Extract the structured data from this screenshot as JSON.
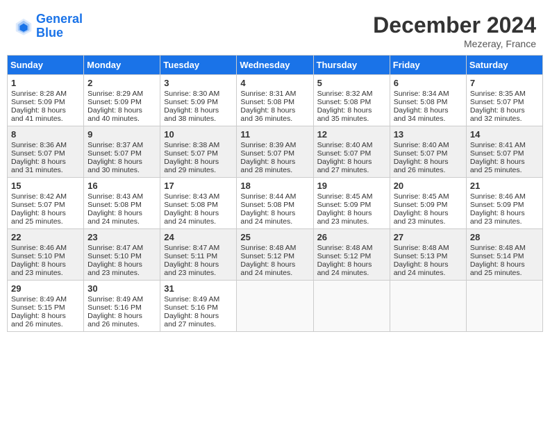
{
  "header": {
    "logo_line1": "General",
    "logo_line2": "Blue",
    "month_title": "December 2024",
    "location": "Mezeray, France"
  },
  "weekdays": [
    "Sunday",
    "Monday",
    "Tuesday",
    "Wednesday",
    "Thursday",
    "Friday",
    "Saturday"
  ],
  "weeks": [
    [
      {
        "day": "1",
        "sunrise": "Sunrise: 8:28 AM",
        "sunset": "Sunset: 5:09 PM",
        "daylight": "Daylight: 8 hours and 41 minutes."
      },
      {
        "day": "2",
        "sunrise": "Sunrise: 8:29 AM",
        "sunset": "Sunset: 5:09 PM",
        "daylight": "Daylight: 8 hours and 40 minutes."
      },
      {
        "day": "3",
        "sunrise": "Sunrise: 8:30 AM",
        "sunset": "Sunset: 5:09 PM",
        "daylight": "Daylight: 8 hours and 38 minutes."
      },
      {
        "day": "4",
        "sunrise": "Sunrise: 8:31 AM",
        "sunset": "Sunset: 5:08 PM",
        "daylight": "Daylight: 8 hours and 36 minutes."
      },
      {
        "day": "5",
        "sunrise": "Sunrise: 8:32 AM",
        "sunset": "Sunset: 5:08 PM",
        "daylight": "Daylight: 8 hours and 35 minutes."
      },
      {
        "day": "6",
        "sunrise": "Sunrise: 8:34 AM",
        "sunset": "Sunset: 5:08 PM",
        "daylight": "Daylight: 8 hours and 34 minutes."
      },
      {
        "day": "7",
        "sunrise": "Sunrise: 8:35 AM",
        "sunset": "Sunset: 5:07 PM",
        "daylight": "Daylight: 8 hours and 32 minutes."
      }
    ],
    [
      {
        "day": "8",
        "sunrise": "Sunrise: 8:36 AM",
        "sunset": "Sunset: 5:07 PM",
        "daylight": "Daylight: 8 hours and 31 minutes."
      },
      {
        "day": "9",
        "sunrise": "Sunrise: 8:37 AM",
        "sunset": "Sunset: 5:07 PM",
        "daylight": "Daylight: 8 hours and 30 minutes."
      },
      {
        "day": "10",
        "sunrise": "Sunrise: 8:38 AM",
        "sunset": "Sunset: 5:07 PM",
        "daylight": "Daylight: 8 hours and 29 minutes."
      },
      {
        "day": "11",
        "sunrise": "Sunrise: 8:39 AM",
        "sunset": "Sunset: 5:07 PM",
        "daylight": "Daylight: 8 hours and 28 minutes."
      },
      {
        "day": "12",
        "sunrise": "Sunrise: 8:40 AM",
        "sunset": "Sunset: 5:07 PM",
        "daylight": "Daylight: 8 hours and 27 minutes."
      },
      {
        "day": "13",
        "sunrise": "Sunrise: 8:40 AM",
        "sunset": "Sunset: 5:07 PM",
        "daylight": "Daylight: 8 hours and 26 minutes."
      },
      {
        "day": "14",
        "sunrise": "Sunrise: 8:41 AM",
        "sunset": "Sunset: 5:07 PM",
        "daylight": "Daylight: 8 hours and 25 minutes."
      }
    ],
    [
      {
        "day": "15",
        "sunrise": "Sunrise: 8:42 AM",
        "sunset": "Sunset: 5:07 PM",
        "daylight": "Daylight: 8 hours and 25 minutes."
      },
      {
        "day": "16",
        "sunrise": "Sunrise: 8:43 AM",
        "sunset": "Sunset: 5:08 PM",
        "daylight": "Daylight: 8 hours and 24 minutes."
      },
      {
        "day": "17",
        "sunrise": "Sunrise: 8:43 AM",
        "sunset": "Sunset: 5:08 PM",
        "daylight": "Daylight: 8 hours and 24 minutes."
      },
      {
        "day": "18",
        "sunrise": "Sunrise: 8:44 AM",
        "sunset": "Sunset: 5:08 PM",
        "daylight": "Daylight: 8 hours and 24 minutes."
      },
      {
        "day": "19",
        "sunrise": "Sunrise: 8:45 AM",
        "sunset": "Sunset: 5:09 PM",
        "daylight": "Daylight: 8 hours and 23 minutes."
      },
      {
        "day": "20",
        "sunrise": "Sunrise: 8:45 AM",
        "sunset": "Sunset: 5:09 PM",
        "daylight": "Daylight: 8 hours and 23 minutes."
      },
      {
        "day": "21",
        "sunrise": "Sunrise: 8:46 AM",
        "sunset": "Sunset: 5:09 PM",
        "daylight": "Daylight: 8 hours and 23 minutes."
      }
    ],
    [
      {
        "day": "22",
        "sunrise": "Sunrise: 8:46 AM",
        "sunset": "Sunset: 5:10 PM",
        "daylight": "Daylight: 8 hours and 23 minutes."
      },
      {
        "day": "23",
        "sunrise": "Sunrise: 8:47 AM",
        "sunset": "Sunset: 5:10 PM",
        "daylight": "Daylight: 8 hours and 23 minutes."
      },
      {
        "day": "24",
        "sunrise": "Sunrise: 8:47 AM",
        "sunset": "Sunset: 5:11 PM",
        "daylight": "Daylight: 8 hours and 23 minutes."
      },
      {
        "day": "25",
        "sunrise": "Sunrise: 8:48 AM",
        "sunset": "Sunset: 5:12 PM",
        "daylight": "Daylight: 8 hours and 24 minutes."
      },
      {
        "day": "26",
        "sunrise": "Sunrise: 8:48 AM",
        "sunset": "Sunset: 5:12 PM",
        "daylight": "Daylight: 8 hours and 24 minutes."
      },
      {
        "day": "27",
        "sunrise": "Sunrise: 8:48 AM",
        "sunset": "Sunset: 5:13 PM",
        "daylight": "Daylight: 8 hours and 24 minutes."
      },
      {
        "day": "28",
        "sunrise": "Sunrise: 8:48 AM",
        "sunset": "Sunset: 5:14 PM",
        "daylight": "Daylight: 8 hours and 25 minutes."
      }
    ],
    [
      {
        "day": "29",
        "sunrise": "Sunrise: 8:49 AM",
        "sunset": "Sunset: 5:15 PM",
        "daylight": "Daylight: 8 hours and 26 minutes."
      },
      {
        "day": "30",
        "sunrise": "Sunrise: 8:49 AM",
        "sunset": "Sunset: 5:16 PM",
        "daylight": "Daylight: 8 hours and 26 minutes."
      },
      {
        "day": "31",
        "sunrise": "Sunrise: 8:49 AM",
        "sunset": "Sunset: 5:16 PM",
        "daylight": "Daylight: 8 hours and 27 minutes."
      },
      null,
      null,
      null,
      null
    ]
  ]
}
